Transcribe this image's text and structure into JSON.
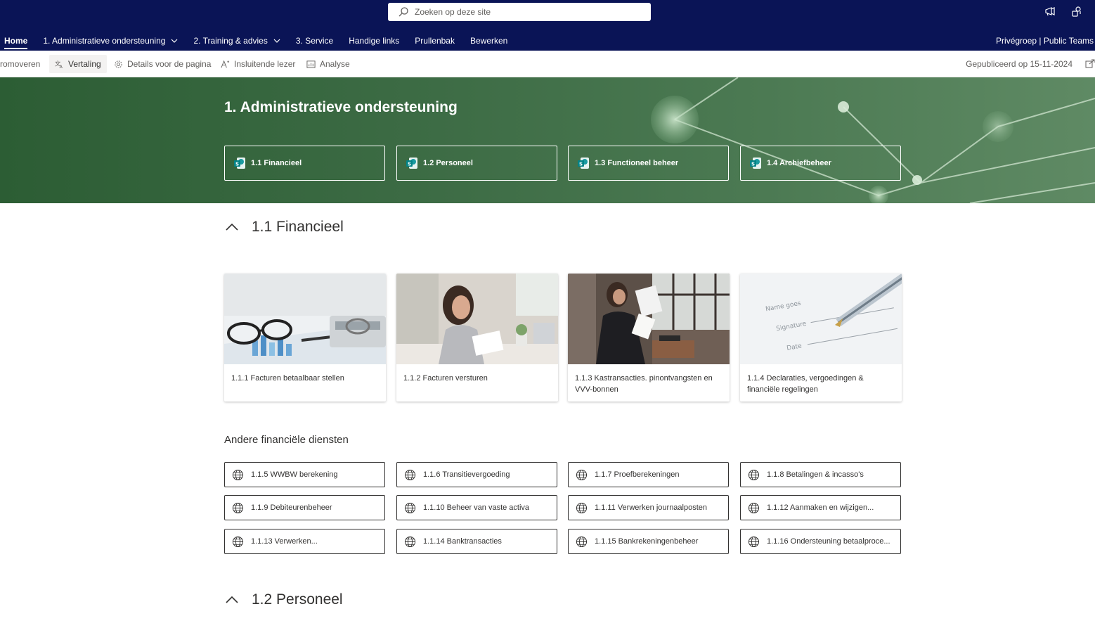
{
  "search": {
    "placeholder": "Zoeken op deze site"
  },
  "nav": {
    "items": [
      {
        "label": "Home"
      },
      {
        "label": "1. Administratieve ondersteuning"
      },
      {
        "label": "2. Training & advies"
      },
      {
        "label": "3. Service"
      },
      {
        "label": "Handige links"
      },
      {
        "label": "Prullenbak"
      },
      {
        "label": "Bewerken"
      }
    ],
    "right_label": "Privégroep | Public Teams"
  },
  "cmdbar": {
    "promote": "romoveren",
    "translation": "Vertaling",
    "page_details": "Details voor de pagina",
    "immersive_reader": "Insluitende lezer",
    "analytics": "Analyse",
    "published": "Gepubliceerd op 15-11-2024"
  },
  "hero": {
    "title": "1. Administratieve ondersteuning",
    "tiles": [
      "1.1 Financieel",
      "1.2 Personeel",
      "1.3 Functioneel beheer",
      "1.4 Archiefbeheer"
    ]
  },
  "section1": {
    "title": "1.1 Financieel",
    "cards": [
      "1.1.1 Facturen betaalbaar stellen",
      "1.1.2 Facturen versturen",
      "1.1.3 Kastransacties. pinontvangsten en VVV-bonnen",
      "1.1.4 Declaraties, vergoedingen & financiële regelingen"
    ],
    "subtitle": "Andere financiële diensten",
    "links": [
      "1.1.5 WWBW berekening",
      "1.1.6 Transitievergoeding",
      "1.1.7 Proefberekeningen",
      "1.1.8 Betalingen & incasso's",
      "1.1.9 Debiteurenbeheer",
      "1.1.10 Beheer van vaste activa",
      "1.1.11 Verwerken journaalposten",
      "1.1.12 Aanmaken en wijzigen...",
      "1.1.13 Verwerken...",
      "1.1.14 Banktransacties",
      "1.1.15 Bankrekeningenbeheer",
      "1.1.16 Ondersteuning betaalproce..."
    ]
  },
  "section2": {
    "title": "1.2 Personeel"
  },
  "colors": {
    "suite_bar": "#0a1456",
    "hero": "#3d6c45",
    "sharepoint": "#038387"
  }
}
